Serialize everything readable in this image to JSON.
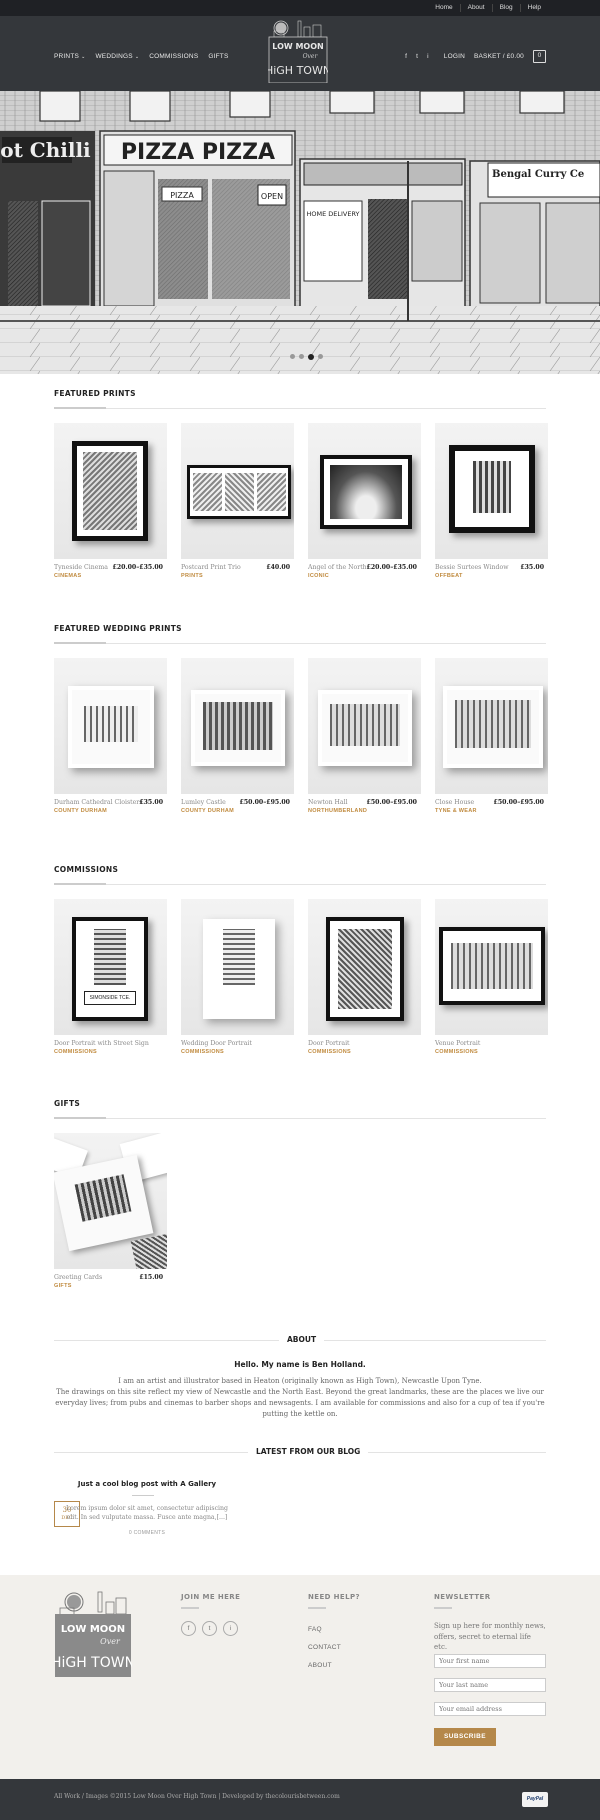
{
  "topbar": {
    "links": [
      "Home",
      "About",
      "Blog",
      "Help"
    ]
  },
  "header": {
    "nav": [
      "PRINTS",
      "WEDDINGS",
      "COMMISSIONS",
      "GIFTS"
    ],
    "login": "LOGIN",
    "basket": "BASKET / £0.00",
    "cart_count": "0",
    "social": [
      "f",
      "t",
      "i"
    ],
    "logo": {
      "line1": "LOW MOON",
      "line2": "Over",
      "line3": "HiGH TOWN"
    }
  },
  "hero": {
    "signs": [
      "Hot Chilli",
      "PIZZA PIZZA",
      "Bengal Curry Ce",
      "PIZZA",
      "OPEN",
      "HOME DELIVERY"
    ],
    "slider_dots": 4,
    "active_dot": 2
  },
  "featured_prints": {
    "title": "FEATURED PRINTS",
    "items": [
      {
        "name": "Tyneside Cinema",
        "price": "£20.00–£35.00",
        "category": "CINEMAS"
      },
      {
        "name": "Postcard Print Trio",
        "price": "£40.00",
        "category": "PRINTS"
      },
      {
        "name": "Angel of the North",
        "price": "£20.00–£35.00",
        "category": "ICONIC"
      },
      {
        "name": "Bessie Surtees Window",
        "price": "£35.00",
        "category": "OFFBEAT"
      }
    ]
  },
  "featured_wedding": {
    "title": "FEATURED WEDDING PRINTS",
    "items": [
      {
        "name": "Durham Cathedral Cloisters",
        "price": "£35.00",
        "category": "COUNTY DURHAM"
      },
      {
        "name": "Lumley Castle",
        "price": "£50.00–£95.00",
        "category": "COUNTY DURHAM"
      },
      {
        "name": "Newton Hall",
        "price": "£50.00–£95.00",
        "category": "NORTHUMBERLAND"
      },
      {
        "name": "Close House",
        "price": "£50.00–£95.00",
        "category": "TYNE & WEAR"
      }
    ]
  },
  "commissions": {
    "title": "COMMISSIONS",
    "sign_text": "SIMONSIDE TCE.",
    "items": [
      {
        "name": "Door Portrait with Street Sign",
        "price": "",
        "category": "COMMISSIONS"
      },
      {
        "name": "Wedding Door Portrait",
        "price": "",
        "category": "COMMISSIONS"
      },
      {
        "name": "Door Portrait",
        "price": "",
        "category": "COMMISSIONS"
      },
      {
        "name": "Venue Portrait",
        "price": "",
        "category": "COMMISSIONS"
      }
    ]
  },
  "gifts": {
    "title": "GIFTS",
    "items": [
      {
        "name": "Greeting Cards",
        "price": "£15.00",
        "category": "GIFTS"
      }
    ]
  },
  "about": {
    "title": "ABOUT",
    "heading": "Hello. My name is Ben Holland.",
    "text1": "I am an artist and illustrator based in Heaton (originally known as High Town), Newcastle Upon Tyne.",
    "text2": "The drawings on this site reflect my view of Newcastle and the North East. Beyond the great landmarks, these are the places we live our everyday lives; from pubs and cinemas to barber shops and newsagents. I am available for commissions and also for a cup of tea if you're putting the kettle on."
  },
  "blog": {
    "title": "LATEST FROM OUR BLOG",
    "post_title": "Just a cool blog post with A Gallery",
    "excerpt": "Lorem ipsum dolor sit amet, consectetur adipiscing elit. In sed vulputate massa. Fusce ante magna,[...]",
    "comments": "0 COMMENTS",
    "date_day": "30",
    "date_month": "DEC"
  },
  "footer": {
    "join_title": "JOIN ME HERE",
    "help_title": "NEED HELP?",
    "help_links": [
      "FAQ",
      "CONTACT",
      "ABOUT"
    ],
    "newsletter_title": "NEWSLETTER",
    "newsletter_text": "Sign up here for monthly news, offers, secret to eternal life etc.",
    "placeholders": [
      "Your first name",
      "Your last name",
      "Your email address"
    ],
    "subscribe": "SUBSCRIBE"
  },
  "bottombar": {
    "copyright": "All Work / Images ©2015 Low Moon Over High Town | Developed by thecolourisbetween.com",
    "paypal": "PayPal"
  },
  "colors": {
    "accent": "#b5884a",
    "header": "#34373b",
    "topbar": "#1f2125",
    "footer_bg": "#f2f0ec"
  }
}
